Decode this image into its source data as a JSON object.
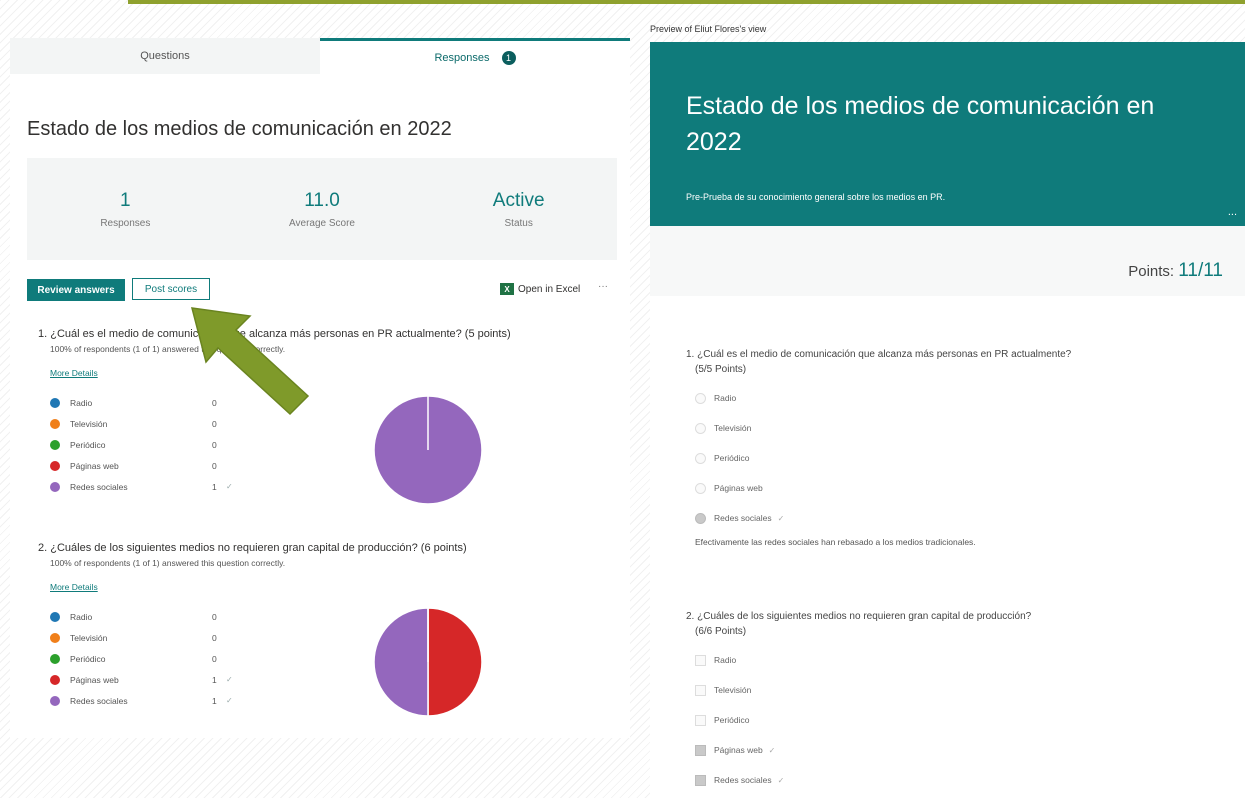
{
  "left": {
    "tabs": [
      {
        "label": "Questions"
      },
      {
        "label": "Responses",
        "badge": "1"
      }
    ],
    "form_title": "Estado de los medios de comunicación en 2022",
    "stats": [
      {
        "value": "1",
        "label": "Responses"
      },
      {
        "value": "11.0",
        "label": "Average Score"
      },
      {
        "value": "Active",
        "label": "Status"
      }
    ],
    "review_button": "Review answers",
    "post_button": "Post scores",
    "open_excel": "Open in Excel",
    "more": "···",
    "questions": [
      {
        "text": "1. ¿Cuál es el  medio de comunicación que alcanza más personas en PR actualmente? (5 points)",
        "subtext": "100% of respondents (1 of 1) answered this question correctly.",
        "more_details": "More Details",
        "options": [
          {
            "label": "Radio",
            "count": "0",
            "color": "#1f77b4",
            "check": ""
          },
          {
            "label": "Televisión",
            "count": "0",
            "color": "#f07f1a",
            "check": ""
          },
          {
            "label": "Periódico",
            "count": "0",
            "color": "#2ca02c",
            "check": ""
          },
          {
            "label": "Páginas web",
            "count": "0",
            "color": "#d62728",
            "check": ""
          },
          {
            "label": "Redes sociales",
            "count": "1",
            "color": "#9467bd",
            "check": "✓"
          }
        ]
      },
      {
        "text": "2. ¿Cuáles de los siguientes medios no requieren gran capital de producción? (6 points)",
        "subtext": "100% of respondents (1 of 1) answered this question correctly.",
        "more_details": "More Details",
        "options": [
          {
            "label": "Radio",
            "count": "0",
            "color": "#1f77b4",
            "check": ""
          },
          {
            "label": "Televisión",
            "count": "0",
            "color": "#f07f1a",
            "check": ""
          },
          {
            "label": "Periódico",
            "count": "0",
            "color": "#2ca02c",
            "check": ""
          },
          {
            "label": "Páginas web",
            "count": "1",
            "color": "#d62728",
            "check": "✓"
          },
          {
            "label": "Redes sociales",
            "count": "1",
            "color": "#9467bd",
            "check": "✓"
          }
        ]
      }
    ],
    "pie_colors": [
      "#1f77b4",
      "#f07f1a",
      "#2ca02c",
      "#d62728",
      "#9467bd"
    ]
  },
  "right": {
    "preview_label": "Preview of Eliut Flores's view",
    "title": "Estado de los medios de comunicación en 2022",
    "description": "Pre-Prueba de su conocimiento general sobre los medios en PR.",
    "dots": "...",
    "points_label": "Points:",
    "points_value": "11/11",
    "questions": [
      {
        "text": "1. ¿Cuál es el  medio de comunicación que alcanza más personas  en PR actualmente?",
        "points": "(5/5 Points)",
        "type": "radio",
        "options": [
          {
            "label": "Radio",
            "selected": false,
            "check": ""
          },
          {
            "label": "Televisión",
            "selected": false,
            "check": ""
          },
          {
            "label": "Periódico",
            "selected": false,
            "check": ""
          },
          {
            "label": "Páginas web",
            "selected": false,
            "check": ""
          },
          {
            "label": "Redes sociales",
            "selected": true,
            "check": "✓"
          }
        ],
        "feedback": "Efectivamente las redes sociales han rebasado a los medios tradicionales."
      },
      {
        "text": "2. ¿Cuáles de los siguientes medios no requieren gran capital de producción?",
        "points": "(6/6 Points)",
        "type": "checkbox",
        "options": [
          {
            "label": "Radio",
            "selected": false,
            "check": ""
          },
          {
            "label": "Televisión",
            "selected": false,
            "check": ""
          },
          {
            "label": "Periódico",
            "selected": false,
            "check": ""
          },
          {
            "label": "Páginas web",
            "selected": true,
            "check": "✓"
          },
          {
            "label": "Redes sociales",
            "selected": true,
            "check": "✓"
          }
        ]
      }
    ]
  },
  "colors": {
    "accent": "#0f7b7b",
    "arrow": "#7f9a2a",
    "top_line": "#8fa12e"
  }
}
